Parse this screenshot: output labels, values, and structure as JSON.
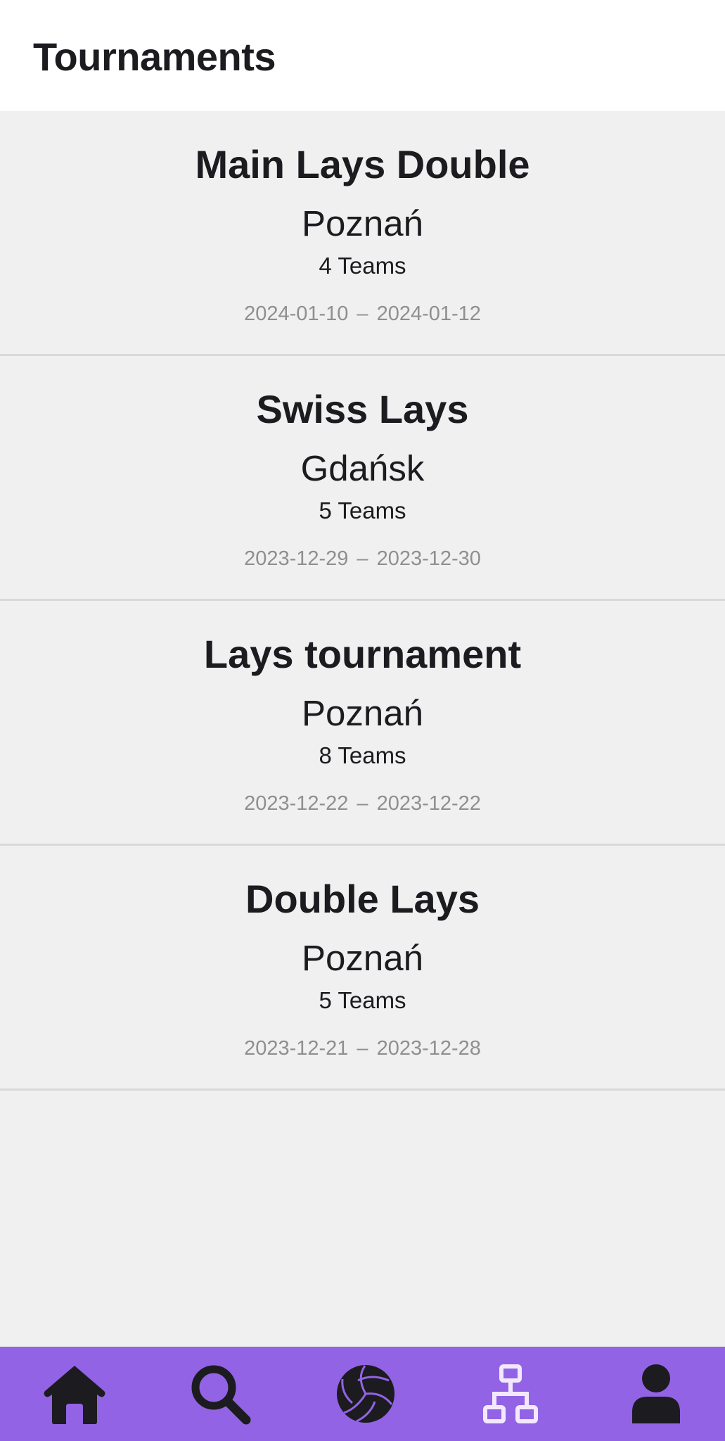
{
  "header": {
    "title": "Tournaments"
  },
  "tournaments": [
    {
      "name": "Main Lays Double",
      "city": "Poznań",
      "teams": "4 Teams",
      "start": "2024-01-10",
      "end": "2024-01-12"
    },
    {
      "name": "Swiss Lays",
      "city": "Gdańsk",
      "teams": "5 Teams",
      "start": "2023-12-29",
      "end": "2023-12-30"
    },
    {
      "name": "Lays tournament",
      "city": "Poznań",
      "teams": "8 Teams",
      "start": "2023-12-22",
      "end": "2023-12-22"
    },
    {
      "name": "Double Lays",
      "city": "Poznań",
      "teams": "5 Teams",
      "start": "2023-12-21",
      "end": "2023-12-28"
    }
  ],
  "date_separator": "–",
  "bottom_nav": {
    "items": [
      {
        "icon": "home-icon",
        "active": false
      },
      {
        "icon": "search-icon",
        "active": false
      },
      {
        "icon": "volleyball-icon",
        "active": true
      },
      {
        "icon": "bracket-icon",
        "active": false
      },
      {
        "icon": "user-icon",
        "active": false
      }
    ]
  },
  "colors": {
    "nav_background": "#9263e5",
    "card_background": "#f0f0f0",
    "header_background": "#ffffff",
    "text_primary": "#1c1b1f",
    "text_secondary": "#8f8f8f",
    "icon_outline_light": "#f3e9ff"
  }
}
